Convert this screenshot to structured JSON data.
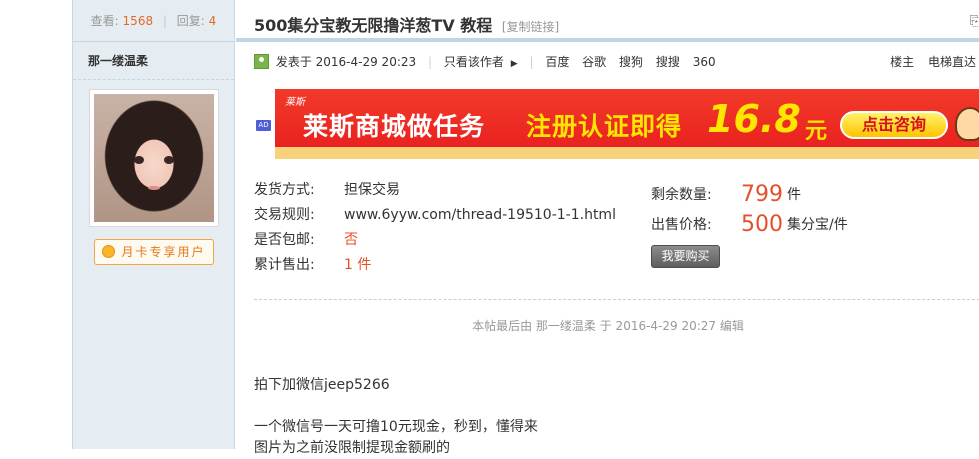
{
  "side": {
    "views_label": "查看:",
    "views": "1568",
    "replies_label": "回复:",
    "replies": "4",
    "username": "那一缕温柔",
    "badge": "月卡专享用户"
  },
  "post": {
    "title": "500集分宝教无限撸洋葱TV 教程",
    "copy_link": "[复制链接]",
    "posted_at": "发表于 2016-4-29 20:23",
    "author_only": "只看该作者",
    "search_links": [
      "百度",
      "谷歌",
      "搜狗",
      "搜搜",
      "360"
    ],
    "floor": "楼主",
    "elevator": "电梯直达"
  },
  "ad": {
    "tag": "AD",
    "brand": "莱斯",
    "slogan_main": "莱斯商城做任务",
    "slogan_highlight": "注册认证即得",
    "amount": "16.8",
    "unit": "元",
    "cta": "点击咨询"
  },
  "trade": {
    "rows": [
      {
        "key": "发货方式:",
        "value": "担保交易"
      },
      {
        "key": "交易规则:",
        "value": "www.6yyw.com/thread-19510-1-1.html"
      },
      {
        "key": "是否包邮:",
        "value": "否"
      },
      {
        "key": "累计售出:",
        "value": "1 件"
      }
    ],
    "remaining_label": "剩余数量:",
    "remaining": "799",
    "remaining_unit": "件",
    "price_label": "出售价格:",
    "price": "500",
    "price_unit": "集分宝/件",
    "buy_button": "我要购买"
  },
  "edit_note": "本帖最后由 那一缕温柔 于 2016-4-29 20:27 编辑",
  "body": {
    "line1": "拍下加微信jeep5266",
    "line2": "一个微信号一天可撸10元现金，秒到，懂得来",
    "line3": "图片为之前没限制提现金额刷的"
  },
  "colors": {
    "accent": "#e4502a",
    "sidebar_bg": "#e5edf2",
    "border": "#c2d5e3"
  }
}
